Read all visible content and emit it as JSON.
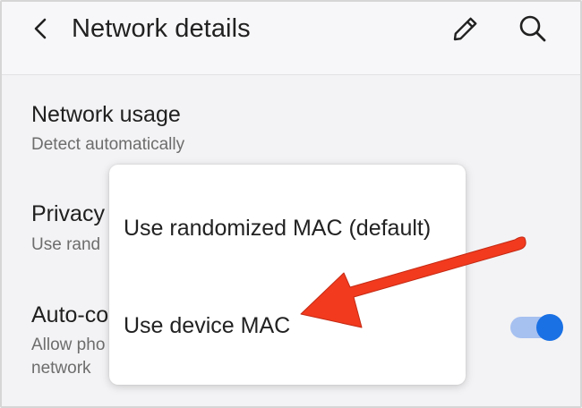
{
  "app": {
    "title": "Network details"
  },
  "header": {
    "back_icon": "chevron-left-icon",
    "edit_icon": "pencil-icon",
    "search_icon": "search-icon"
  },
  "settings": {
    "network_usage": {
      "title": "Network usage",
      "subtitle": "Detect automatically"
    },
    "privacy": {
      "title": "Privacy",
      "subtitle": "Use rand"
    },
    "auto_connect": {
      "title": "Auto-co",
      "subtitle_line1": "Allow pho",
      "subtitle_line2": "network",
      "toggle_on": true
    }
  },
  "popup": {
    "options": [
      {
        "label": "Use randomized MAC (default)"
      },
      {
        "label": "Use device MAC"
      }
    ]
  },
  "annotation": {
    "arrow_color": "#f23a1e"
  },
  "colors": {
    "accent": "#1b73e8",
    "toggle_track": "#a9c4f4"
  }
}
